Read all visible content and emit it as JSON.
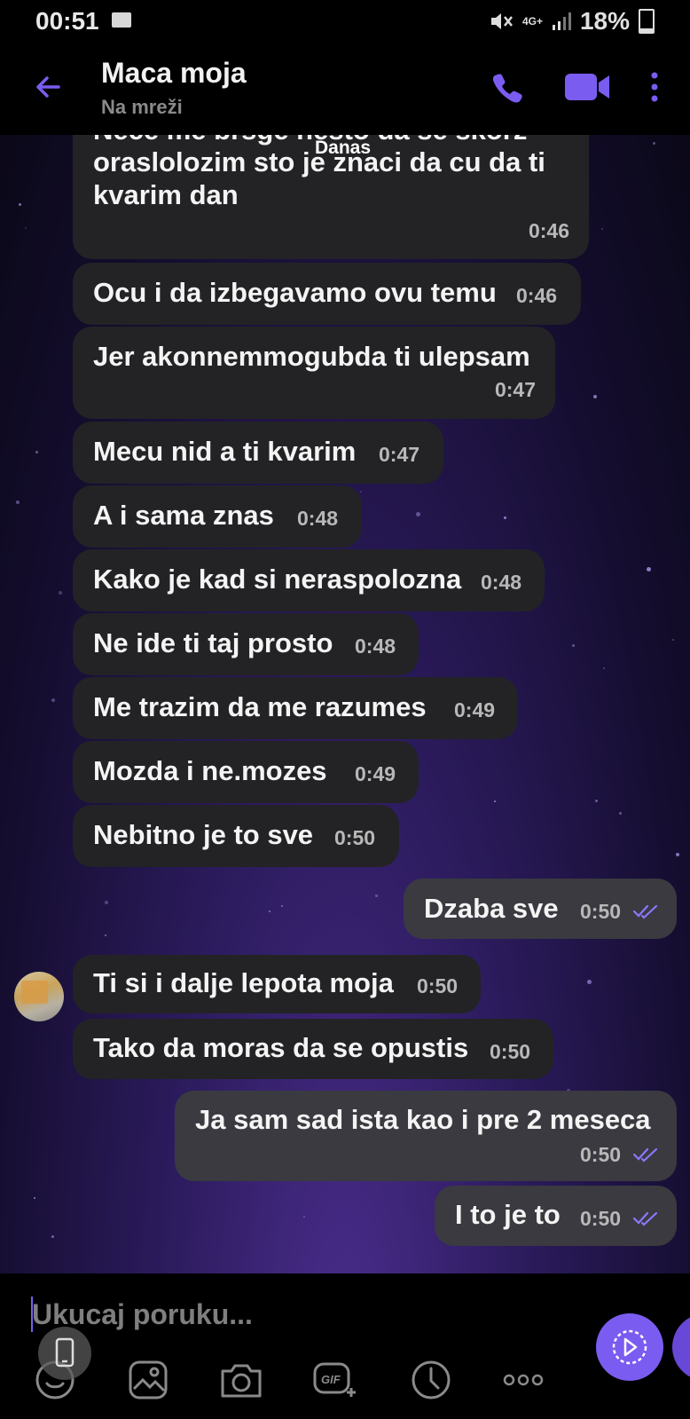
{
  "status_bar": {
    "time": "00:51",
    "network": "4G+",
    "battery": "18%"
  },
  "header": {
    "contact_name": "Maca moja",
    "presence": "Na mreži"
  },
  "chat": {
    "date_separator": "Danas",
    "messages": [
      {
        "dir": "in",
        "lines": [
          "Nece me brsge nesto da se skorz",
          "oraslolozim sto je znaci da cu da ti",
          "kvarim dan"
        ],
        "time": "0:46"
      },
      {
        "dir": "in",
        "lines": [
          "Ocu i da izbegavamo ovu temu"
        ],
        "time": "0:46"
      },
      {
        "dir": "in",
        "lines": [
          "Jer akonnemmogubda ti ulepsam"
        ],
        "time": "0:47"
      },
      {
        "dir": "in",
        "lines": [
          "Mecu nid a ti kvarim"
        ],
        "time": "0:47"
      },
      {
        "dir": "in",
        "lines": [
          "A i sama znas"
        ],
        "time": "0:48"
      },
      {
        "dir": "in",
        "lines": [
          "Kako je kad si neraspolozna"
        ],
        "time": "0:48"
      },
      {
        "dir": "in",
        "lines": [
          "Ne ide ti taj prosto"
        ],
        "time": "0:48"
      },
      {
        "dir": "in",
        "lines": [
          "Me trazim da me razumes"
        ],
        "time": "0:49"
      },
      {
        "dir": "in",
        "lines": [
          "Mozda i ne.mozes"
        ],
        "time": "0:49"
      },
      {
        "dir": "in",
        "lines": [
          "Nebitno je to sve"
        ],
        "time": "0:50"
      },
      {
        "dir": "out",
        "lines": [
          "Dzaba sve"
        ],
        "time": "0:50"
      },
      {
        "dir": "in",
        "lines": [
          "Ti si i dalje lepota moja"
        ],
        "time": "0:50"
      },
      {
        "dir": "in",
        "lines": [
          "Tako da moras da se opustis"
        ],
        "time": "0:50"
      },
      {
        "dir": "out",
        "lines": [
          "Ja sam sad ista kao i pre 2 meseca"
        ],
        "time": "0:50"
      },
      {
        "dir": "out",
        "lines": [
          "I to je to"
        ],
        "time": "0:50"
      }
    ]
  },
  "composer": {
    "placeholder": "Ukucaj poruku...",
    "tools": [
      "emoji-icon",
      "gallery-icon",
      "camera-icon",
      "gif-icon",
      "clock-icon",
      "more-icon"
    ]
  },
  "colors": {
    "accent": "#7b5cf0",
    "incoming_bubble": "#232326",
    "outgoing_bubble": "#3a3a40"
  }
}
